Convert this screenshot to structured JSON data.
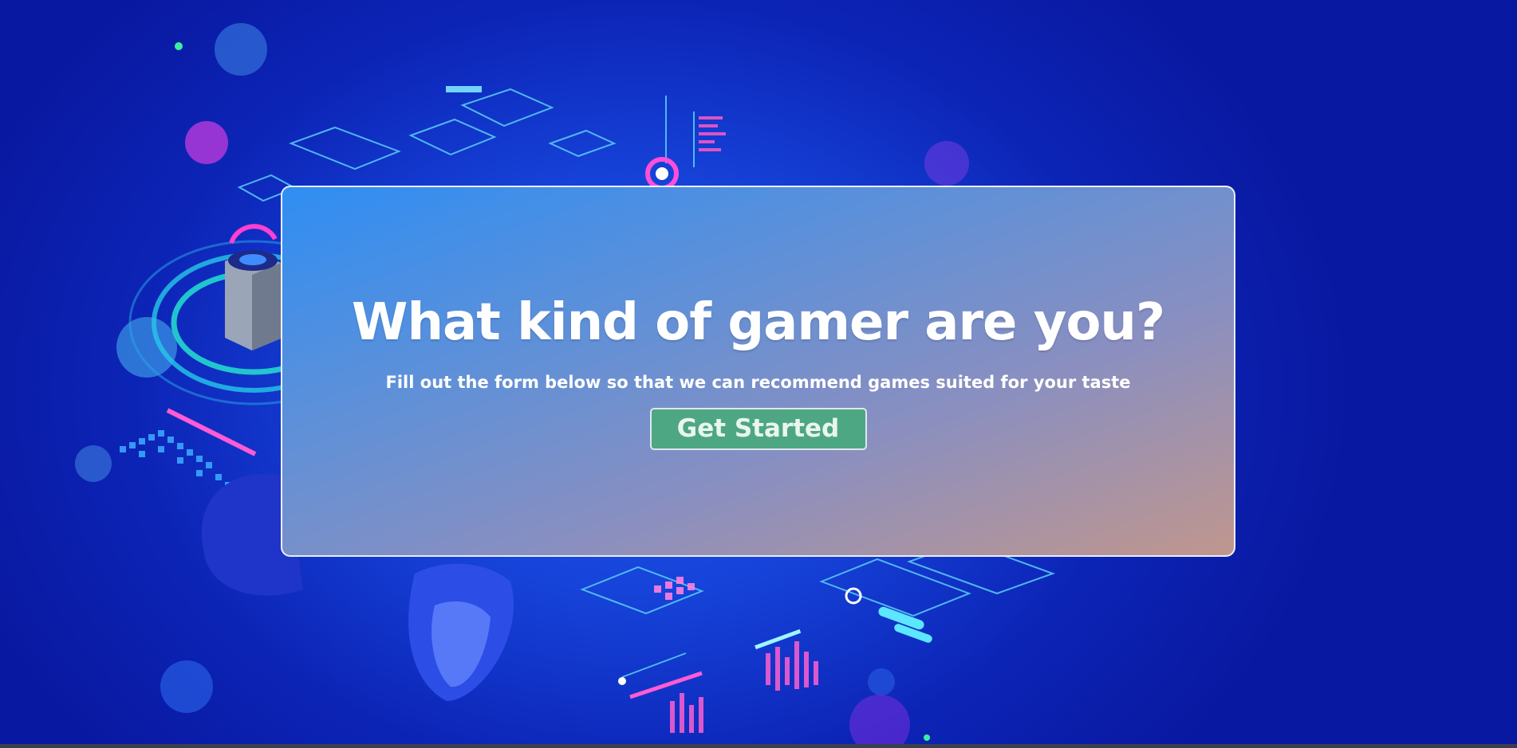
{
  "hero": {
    "title": "What kind of gamer are you?",
    "subtitle": "Fill out the form below so that we can recommend games suited for your taste",
    "cta_label": "Get Started"
  },
  "colors": {
    "cta_background": "#4ea783",
    "background_blue": "#1642d8"
  }
}
